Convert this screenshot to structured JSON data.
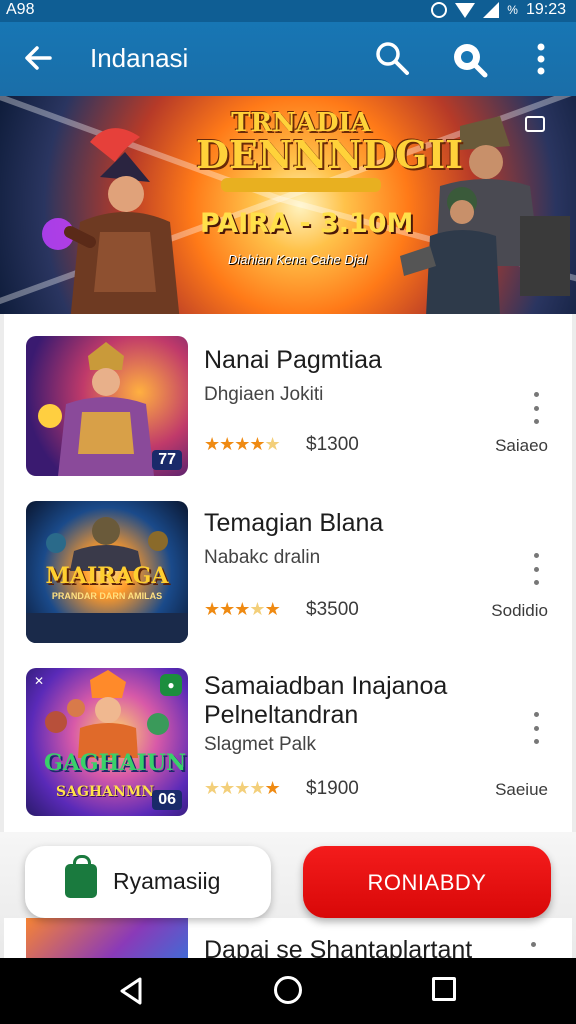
{
  "status_bar": {
    "carrier": "A98",
    "time": "19:23",
    "battery_text": "%",
    "icons": [
      "alarm-icon",
      "wifi-icon",
      "signal-icon",
      "battery-icon"
    ]
  },
  "app_bar": {
    "title": "Indanasi",
    "icons": [
      "back-arrow-icon",
      "search-icon",
      "search-alt-icon",
      "more-vert-icon"
    ]
  },
  "banner": {
    "headline_line1": "TRNADIA",
    "headline_line2": "DENNNDGII",
    "price_text": "PAIRA - 3.10M",
    "tagline": "Diahian Kena Cahe Djal"
  },
  "items": [
    {
      "name": "Nanai Pagmtiaa",
      "subtitle": "Dhgiaen Jokiti",
      "rating": 4.5,
      "price": "$1300",
      "tag": "Saiaeo",
      "badge": "77"
    },
    {
      "name": "Temagian Blana",
      "subtitle": "Nabakc dralin",
      "rating": 3.5,
      "price": "$3500",
      "tag": "Sodidio",
      "art_title": "MAIRAGA",
      "art_subtitle": "PRANDAR DARN AMILAS"
    },
    {
      "name_line1": "Samaiadban Inajanoa",
      "name_line2": "Pelneltandran",
      "subtitle": "Slagmet Palk",
      "rating": 3.5,
      "price": "$1900",
      "tag": "Saeiue",
      "art_logo": "GAGHAIUN",
      "art_caption": "SAGHANMN",
      "badge": "06"
    }
  ],
  "actions": {
    "left_label": "Ryamasiig",
    "right_label": "RONIABDY"
  },
  "peek_item": {
    "name": "Dapai se Shantaplartant"
  },
  "colors": {
    "app_bar": "#1776b4",
    "status_bar": "#0f5e94",
    "star": "#ef8a12",
    "primary_button": "#e81414",
    "bag_icon": "#1a7a3e"
  }
}
